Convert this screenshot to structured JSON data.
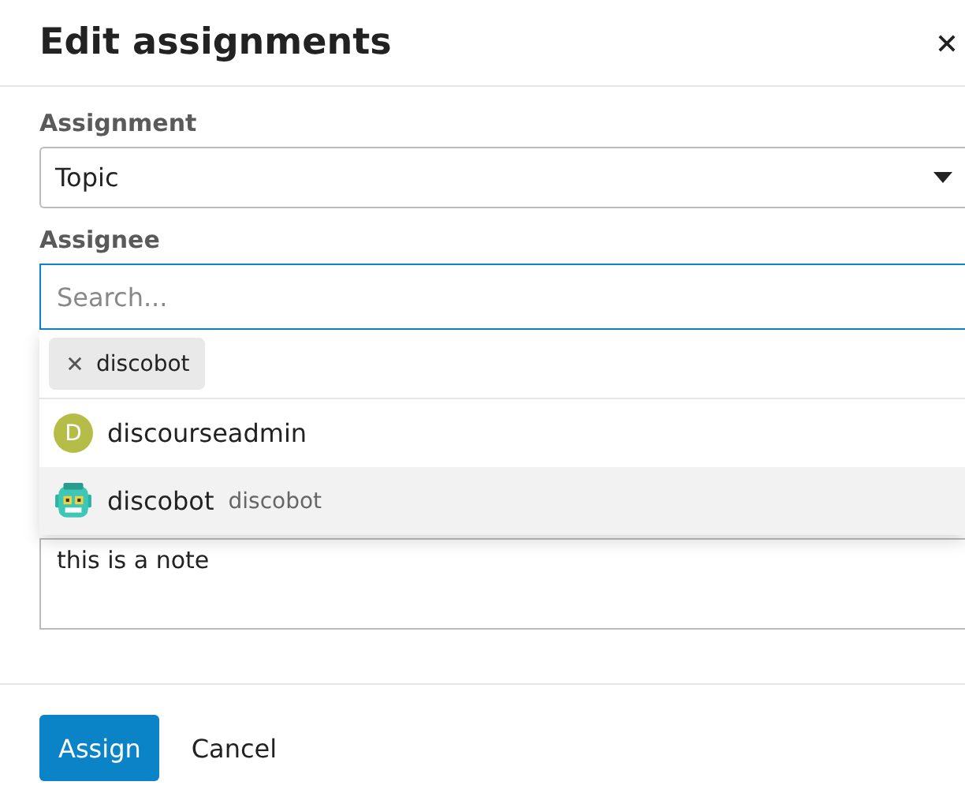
{
  "modal": {
    "title": "Edit assignments"
  },
  "assignment": {
    "label": "Assignment",
    "value": "Topic"
  },
  "assignee": {
    "label": "Assignee",
    "placeholder": "Search...",
    "chips": [
      {
        "label": "discobot"
      }
    ],
    "options": [
      {
        "name": "discourseadmin",
        "avatar": {
          "kind": "letter",
          "letter": "D",
          "color": "#b5bd48"
        },
        "selected": false
      },
      {
        "name": "discobot",
        "username": "discobot",
        "avatar": {
          "kind": "robot"
        },
        "selected": true
      }
    ]
  },
  "note": {
    "value": "this is a note"
  },
  "buttons": [
    {
      "label": "Assign",
      "kind": "primary"
    },
    {
      "label": "Cancel",
      "kind": "flat"
    }
  ]
}
